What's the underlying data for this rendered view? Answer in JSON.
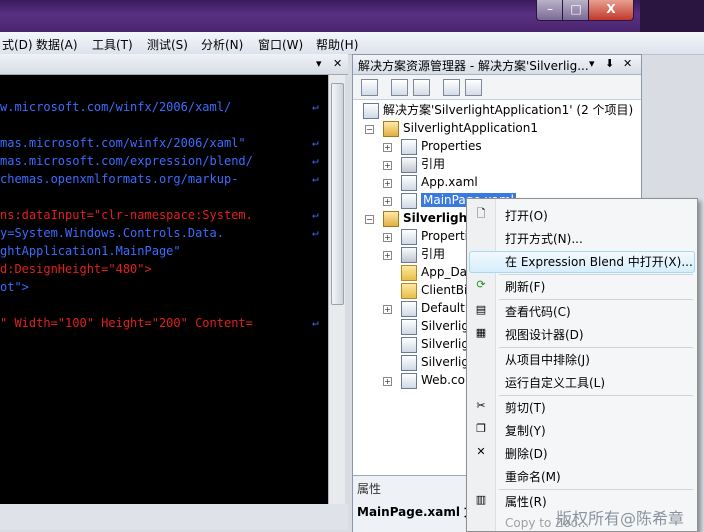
{
  "window": {
    "minimize_glyph": "–",
    "maximize_glyph": "□",
    "close_glyph": "X"
  },
  "menubar": {
    "items": [
      "式(D)",
      "数据(A)",
      "工具(T)",
      "测试(S)",
      "分析(N)",
      "窗口(W)",
      "帮助(H)"
    ]
  },
  "editor": {
    "tab_controls": [
      "▾",
      "✕"
    ],
    "lines": [
      {
        "text": "w.microsoft.com/winfx/2006/xaml/",
        "color": "blue"
      },
      {
        "text": "mas.microsoft.com/winfx/2006/xaml\"",
        "color": "blue"
      },
      {
        "text": "mas.microsoft.com/expression/blend/",
        "color": "blue"
      },
      {
        "text": "chemas.openxmlformats.org/markup-",
        "color": "blue"
      },
      {
        "text": "ns:dataInput=\"clr-namespace:System.",
        "color": "mix"
      },
      {
        "text": "y=System.Windows.Controls.Data.",
        "color": "blue"
      },
      {
        "text": "ghtApplication1.MainPage\"",
        "color": "blue"
      },
      {
        "text": "d:DesignHeight=\"480\">",
        "color": "mix"
      },
      {
        "text": "ot\">",
        "color": "blue"
      },
      {
        "text": "\" Width=\"100\" Height=\"200\" Content=",
        "color": "mix"
      }
    ],
    "wrap_glyph": "↵"
  },
  "solution_explorer": {
    "title": "解决方案资源管理器 - 解决方案'Silverlig...",
    "title_controls": [
      "▾",
      "⬇",
      "✕"
    ],
    "root": "解决方案'SilverlightApplication1' (2 个项目)",
    "project1": "SilverlightApplication1",
    "project1_items": [
      "Properties",
      "引用",
      "App.xaml",
      "MainPage.xaml"
    ],
    "project2": "SilverlightA",
    "project2_items": [
      "Propertie",
      "引用",
      "App_Da",
      "ClientBi",
      "Default.",
      "Silverlig",
      "Silverlig",
      "Silverlig",
      "Web.co"
    ],
    "properties_header": "属性",
    "properties_file": "MainPage.xaml 文件"
  },
  "context_menu": {
    "items": [
      {
        "label": "打开(O)",
        "icon": "open-icon"
      },
      {
        "label": "打开方式(N)...",
        "icon": ""
      },
      {
        "label": "在 Expression Blend 中打开(X)...",
        "icon": ""
      },
      {
        "label": "刷新(F)",
        "icon": "refresh-icon"
      },
      {
        "label": "查看代码(C)",
        "icon": "view-code-icon"
      },
      {
        "label": "视图设计器(D)",
        "icon": "designer-icon"
      },
      {
        "label": "从项目中排除(J)",
        "icon": ""
      },
      {
        "label": "运行自定义工具(L)",
        "icon": ""
      },
      {
        "label": "剪切(T)",
        "icon": "cut-icon"
      },
      {
        "label": "复制(Y)",
        "icon": "copy-icon"
      },
      {
        "label": "删除(D)",
        "icon": "delete-icon"
      },
      {
        "label": "重命名(M)",
        "icon": ""
      },
      {
        "label": "属性(R)",
        "icon": "properties-icon"
      },
      {
        "label": "Copy to Zoo...",
        "icon": ""
      }
    ]
  },
  "watermark": "版权所有@陈希章",
  "colors": {
    "code_bg": "#000000",
    "keyword_blue": "#3b6cff",
    "attr_red": "#e02020",
    "selection": "#3a7ae0"
  }
}
